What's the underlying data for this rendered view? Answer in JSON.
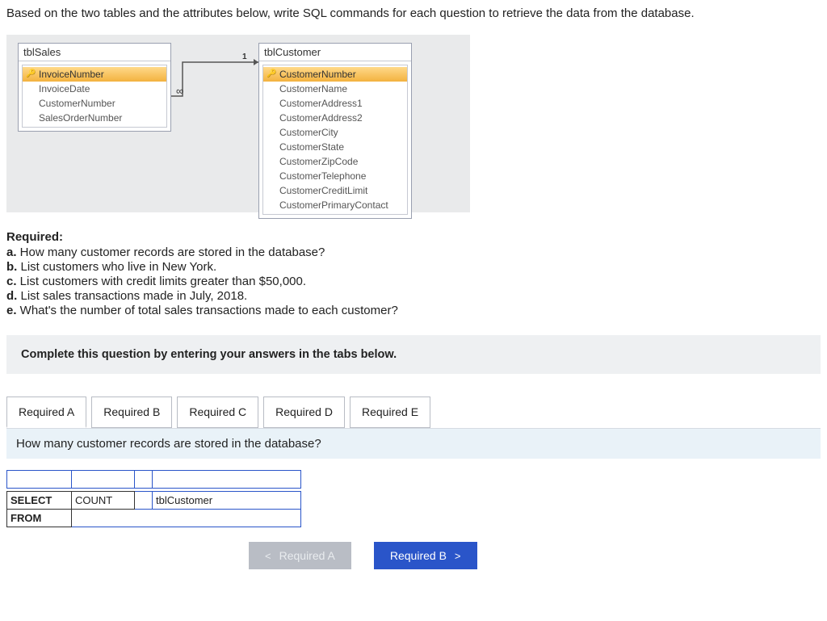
{
  "intro": "Based on the two tables and the attributes below, write SQL commands for each question to retrieve the data from the database.",
  "tables": {
    "left": {
      "name": "tblSales",
      "rows": [
        {
          "label": "InvoiceNumber",
          "pk": true
        },
        {
          "label": "InvoiceDate",
          "pk": false
        },
        {
          "label": "CustomerNumber",
          "pk": false
        },
        {
          "label": "SalesOrderNumber",
          "pk": false
        }
      ]
    },
    "right": {
      "name": "tblCustomer",
      "rows": [
        {
          "label": "CustomerNumber",
          "pk": true
        },
        {
          "label": "CustomerName",
          "pk": false
        },
        {
          "label": "CustomerAddress1",
          "pk": false
        },
        {
          "label": "CustomerAddress2",
          "pk": false
        },
        {
          "label": "CustomerCity",
          "pk": false
        },
        {
          "label": "CustomerState",
          "pk": false
        },
        {
          "label": "CustomerZipCode",
          "pk": false
        },
        {
          "label": "CustomerTelephone",
          "pk": false
        },
        {
          "label": "CustomerCreditLimit",
          "pk": false
        },
        {
          "label": "CustomerPrimaryContact",
          "pk": false
        }
      ]
    },
    "rel": {
      "one": "1",
      "many": "∞"
    }
  },
  "required": {
    "heading": "Required:",
    "items": [
      {
        "lead": "a.",
        "text": " How many customer records are stored in the database?"
      },
      {
        "lead": "b.",
        "text": " List customers who live in New York."
      },
      {
        "lead": "c.",
        "text": " List customers with credit limits greater than $50,000."
      },
      {
        "lead": "d.",
        "text": " List sales transactions made in July, 2018."
      },
      {
        "lead": "e.",
        "text": " What's the number of total sales transactions made to each customer?"
      }
    ]
  },
  "instruction": "Complete this question by entering your answers in the tabs below.",
  "tabs": [
    "Required A",
    "Required B",
    "Required C",
    "Required D",
    "Required E"
  ],
  "active_tab_index": 0,
  "question": "How many customer records are stored in the database?",
  "answer": {
    "r1": {
      "c1": "SELECT",
      "c2": "COUNT",
      "c3": "",
      "c4": "tblCustomer"
    },
    "r2": {
      "c1": "FROM",
      "c2wide": ""
    }
  },
  "nav": {
    "prev": "Required A",
    "next": "Required B"
  }
}
